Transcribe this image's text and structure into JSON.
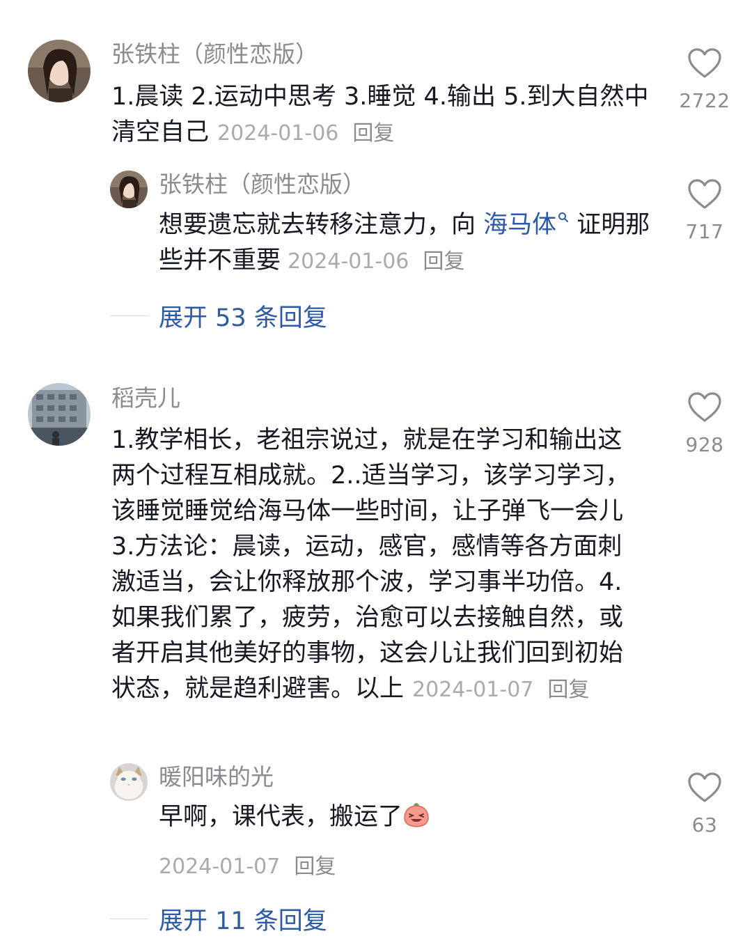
{
  "comments": [
    {
      "username": "张铁柱（颜性恋版）",
      "text": "1.晨读 2.运动中思考 3.睡觉 4.输出 5.到大自然中清空自己",
      "date": "2024-01-06",
      "reply_label": "回复",
      "likes": "2722",
      "replies": [
        {
          "username": "张铁柱（颜性恋版）",
          "text_before": "想要遗忘就去转移注意力，向 ",
          "link_text": "海马体",
          "text_after": " 证明那些并不重要",
          "date": "2024-01-06",
          "reply_label": "回复",
          "likes": "717"
        }
      ],
      "expand_label": "展开 53 条回复"
    },
    {
      "username": "稻壳儿",
      "text": "1.教学相长，老祖宗说过，就是在学习和输出这两个过程互相成就。2..适当学习，该学习学习，该睡觉睡觉给海马体一些时间，让子弹飞一会儿 3.方法论：晨读，运动，感官，感情等各方面刺激适当，会让你释放那个波，学习事半功倍。4.如果我们累了，疲劳，治愈可以去接触自然，或者开启其他美好的事物，这会儿让我们回到初始状态，就是趋利避害。以上",
      "date": "2024-01-07",
      "reply_label": "回复",
      "likes": "928",
      "replies": [
        {
          "username": "暖阳味的光",
          "text": "早啊，课代表，搬运了",
          "date": "2024-01-07",
          "reply_label": "回复",
          "likes": "63"
        }
      ],
      "expand_label": "展开 11 条回复"
    }
  ],
  "icons": {
    "like": "heart-outline-icon",
    "link_search": "search-icon",
    "emoji": "laughing-peach-emoji"
  },
  "colors": {
    "link": "#2b5ba8",
    "username": "#8a8b91",
    "meta": "#a9aaae"
  }
}
